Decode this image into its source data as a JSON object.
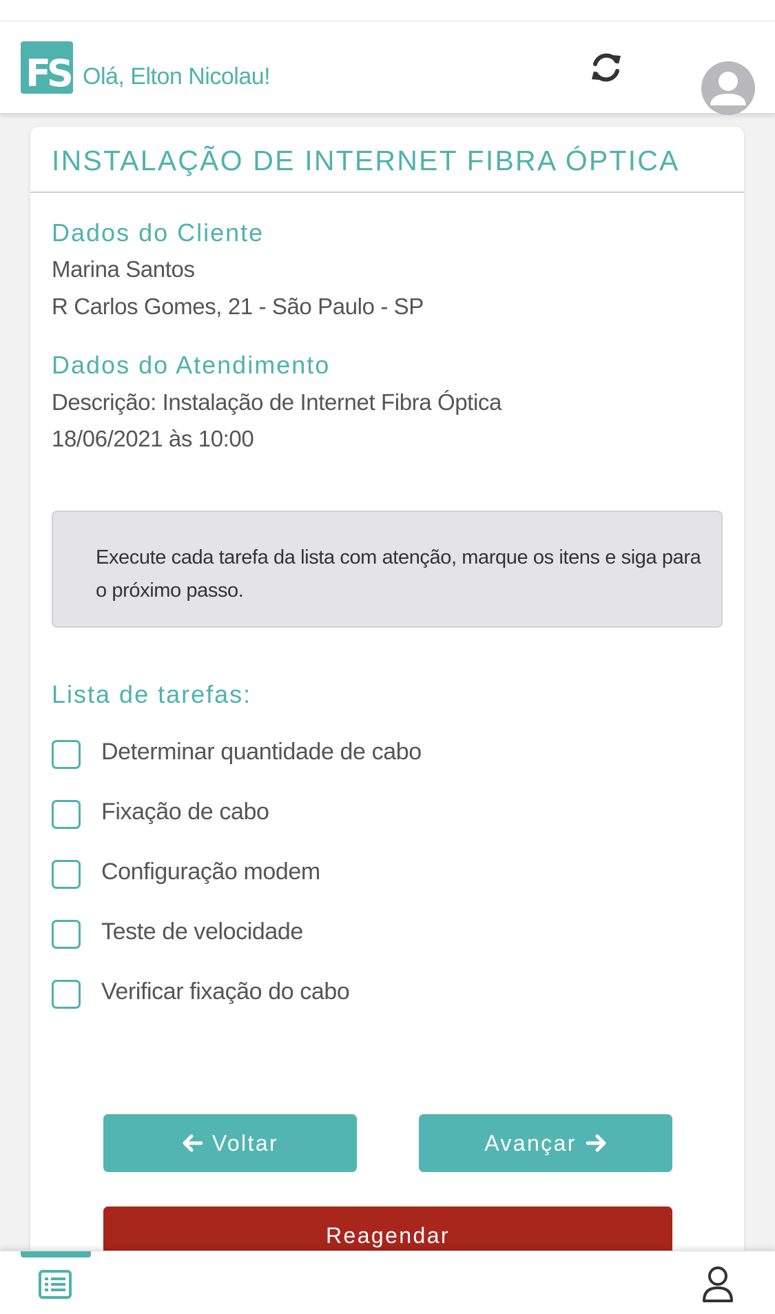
{
  "header": {
    "logo_text": "FS",
    "greeting": "Olá, Elton Nicolau!"
  },
  "card": {
    "title": "INSTALAÇÃO DE INTERNET FIBRA ÓPTICA",
    "client": {
      "heading": "Dados do Cliente",
      "name": "Marina Santos",
      "address": "R Carlos Gomes, 21 - São Paulo - SP"
    },
    "service": {
      "heading": "Dados do Atendimento",
      "description": "Descrição: Instalação de Internet Fibra Óptica",
      "datetime": "18/06/2021 às 10:00"
    },
    "notice": "Execute cada tarefa da lista com atenção, marque os itens e siga para o próximo passo.",
    "tasks": {
      "heading": "Lista de tarefas:",
      "items": [
        {
          "label": "Determinar quantidade de cabo",
          "checked": false
        },
        {
          "label": "Fixação de cabo",
          "checked": false
        },
        {
          "label": "Configuração modem",
          "checked": false
        },
        {
          "label": "Teste de velocidade",
          "checked": false
        },
        {
          "label": "Verificar fixação do cabo",
          "checked": false
        }
      ]
    },
    "buttons": {
      "back": "Voltar",
      "next": "Avançar",
      "reschedule": "Reagendar"
    }
  },
  "colors": {
    "accent": "#4fb2ad",
    "danger": "#a8261c",
    "notice_bg": "#e4e4e6"
  },
  "icons": {
    "refresh": "refresh-icon",
    "avatar": "user-avatar-icon",
    "back": "arrow-left-icon",
    "next": "arrow-right-icon",
    "tab_list": "list-icon",
    "tab_profile": "user-icon"
  }
}
